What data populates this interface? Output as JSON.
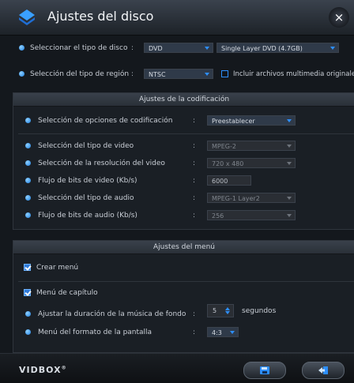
{
  "title": "Ajustes del disco",
  "close_label": "×",
  "disc_type": {
    "label": "Seleccionar el tipo de disco",
    "colon": ":",
    "format": "DVD",
    "layer": "Single Layer DVD (4.7GB)"
  },
  "region": {
    "label": "Selección del tipo de región",
    "colon": ":",
    "value": "NTSC",
    "include_label": "Incluir archivos multimedia originales",
    "include_checked": false
  },
  "coding": {
    "header": "Ajustes de la codificación",
    "rows": [
      {
        "label": "Selección de opciones de codificación",
        "colon": ":",
        "value": "Preestablecer"
      },
      {
        "label": "Selección del tipo de video",
        "colon": ":",
        "value": "MPEG-2"
      },
      {
        "label": "Selección de la resolución del video",
        "colon": ":",
        "value": "720 x 480"
      },
      {
        "label": "Flujo de bits de video (Kb/s)",
        "colon": ":",
        "value": "6000"
      },
      {
        "label": "Selección del tipo de audio",
        "colon": ":",
        "value": "MPEG-1 Layer2"
      },
      {
        "label": "Flujo de bits de audio (Kb/s)",
        "colon": ":",
        "value": "256"
      }
    ]
  },
  "menu": {
    "header": "Ajustes del menú",
    "create_menu": "Crear menú",
    "chapter_menu": "Menú de capítulo",
    "music_label": "Ajustar la duración de la música de fondo",
    "music_colon": ":",
    "music_value": "5",
    "music_unit": "segundos",
    "format_label": "Menú del formato de la pantalla",
    "format_colon": ":",
    "format_value": "4:3"
  },
  "footer": {
    "brand": "VIDBOX",
    "brand_mark": "®"
  },
  "colors": {
    "accent": "#2d8fff",
    "background": "#14181d"
  }
}
